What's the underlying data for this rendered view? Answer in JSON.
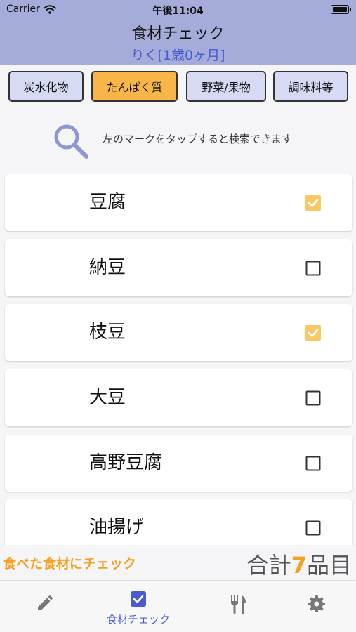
{
  "status_bar": {
    "carrier": "Carrier",
    "time": "午後11:04"
  },
  "header": {
    "title": "食材チェック",
    "subtitle": "りく[1歳0ヶ月]"
  },
  "categories": [
    {
      "label": "炭水化物",
      "active": false
    },
    {
      "label": "たんぱく質",
      "active": true
    },
    {
      "label": "野菜/果物",
      "active": false
    },
    {
      "label": "調味料等",
      "active": false
    }
  ],
  "search_hint": {
    "text": "左のマークをタップすると検索できます",
    "icon": "magnifier-icon"
  },
  "foods": [
    {
      "name": "豆腐",
      "checked": true
    },
    {
      "name": "納豆",
      "checked": false
    },
    {
      "name": "枝豆",
      "checked": true
    },
    {
      "name": "大豆",
      "checked": false
    },
    {
      "name": "高野豆腐",
      "checked": false
    },
    {
      "name": "油揚げ",
      "checked": false
    }
  ],
  "summary": {
    "left": "食べた食材にチェック",
    "prefix": "合計",
    "count": "7",
    "suffix": "品目"
  },
  "tabs": [
    {
      "icon": "pencil-icon",
      "label": "",
      "active": false
    },
    {
      "icon": "checkbox-icon",
      "label": "食材チェック",
      "active": true
    },
    {
      "icon": "cutlery-icon",
      "label": "",
      "active": false
    },
    {
      "icon": "gear-icon",
      "label": "",
      "active": false
    }
  ],
  "colors": {
    "header_bg": "#a5acd9",
    "accent": "#4a5bd1",
    "orange": "#f5a020",
    "active_category": "#f8b548",
    "check": "#f8c865"
  }
}
